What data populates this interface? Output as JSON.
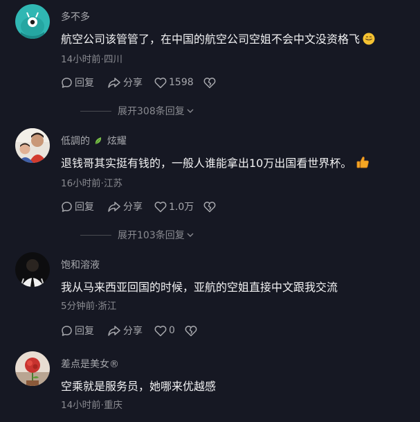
{
  "comments": [
    {
      "username": "多不多",
      "content": "航空公司该管管了，在中国的航空公司空姐不会中文没资格飞",
      "meta": "14小时前·四川",
      "reply_label": "回复",
      "share_label": "分享",
      "like_count": "1598",
      "replies_expand_label": "展开308条回复",
      "emoji_icon": "grinning-emoji-icon"
    },
    {
      "username": "低調的",
      "username_suffix": "炫耀",
      "content": "退钱哥其实挺有钱的，一般人谁能拿出10万出国看世界杯。",
      "meta": "16小时前·江苏",
      "reply_label": "回复",
      "share_label": "分享",
      "like_count": "1.0万",
      "replies_expand_label": "展开103条回复",
      "emoji_icon": "thumbs-up-emoji-icon"
    },
    {
      "username": "饱和溶液",
      "content": "我从马来西亚回国的时候，亚航的空姐直接中文跟我交流",
      "meta": "5分钟前·浙江",
      "reply_label": "回复",
      "share_label": "分享",
      "like_count": "0"
    },
    {
      "username": "差点是美女®",
      "content": "空乘就是服务员，她哪来优越感",
      "meta": "14小时前·重庆"
    }
  ],
  "colors": {
    "background": "#161823",
    "text_primary": "#f2f2f3",
    "text_secondary": "#a7a8ad",
    "text_meta": "#8a8b91"
  }
}
